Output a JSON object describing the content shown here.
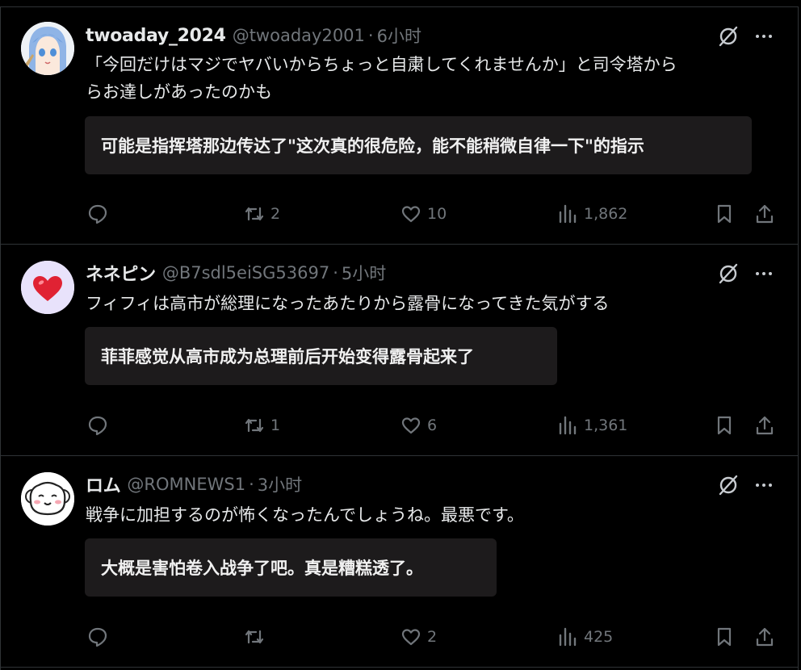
{
  "colors": {
    "background": "#000000",
    "border": "#2f3336",
    "muted": "#71767b",
    "text": "#e7e9ea",
    "translation_bg": "#1d1b1c"
  },
  "posts": [
    {
      "name": "twoaday_2024",
      "handle": "@twoaday2001",
      "sep": "·",
      "time": "6小时",
      "text": "「今回だけはマジでヤバいからちょっと自粛してくれませんか」と司令塔から\nらお達しがあったのかも",
      "translation": "可能是指挥塔那边传达了\"这次真的很危险，能不能稍微自律一下\"的指示",
      "replies": "",
      "reposts": "2",
      "likes": "10",
      "views": "1,862",
      "avatar_icon": "anime-girl-avatar"
    },
    {
      "name": "ネネピン",
      "handle": "@B7sdl5eiSG53697",
      "sep": "·",
      "time": "5小时",
      "text": "フィフィは高市が総理になったあたりから露骨になってきた気がする",
      "translation": "菲菲感觉从高市成为总理前后开始变得露骨起来了",
      "replies": "",
      "reposts": "1",
      "likes": "6",
      "views": "1,361",
      "avatar_icon": "heart-avatar"
    },
    {
      "name": "ロム",
      "handle": "@ROMNEWS1",
      "sep": "·",
      "time": "3小时",
      "text": "戦争に加担するのが怖くなったんでしょうね。最悪です。",
      "translation": "大概是害怕卷入战争了吧。真是糟糕透了。",
      "replies": "",
      "reposts": "",
      "likes": "2",
      "views": "425",
      "avatar_icon": "sheep-avatar"
    }
  ],
  "icons": [
    "grok-icon",
    "more-icon",
    "reply-icon",
    "repost-icon",
    "like-icon",
    "views-icon",
    "bookmark-icon",
    "share-icon"
  ]
}
